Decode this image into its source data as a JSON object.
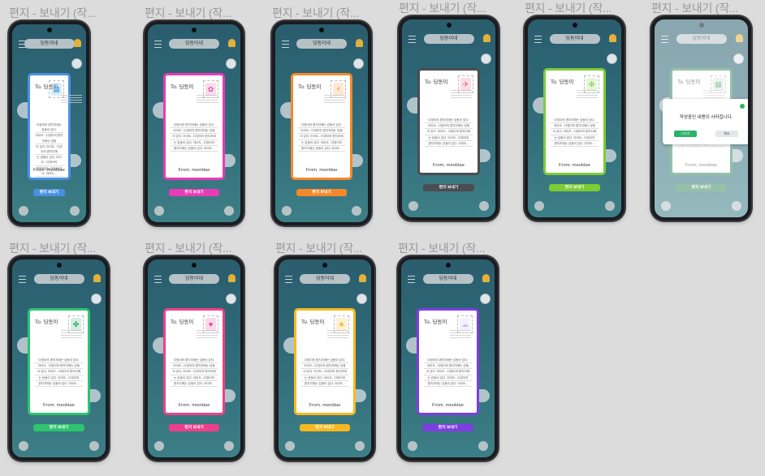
{
  "frames": [
    {
      "title": "편지 - 보내기 (작...",
      "accent": "#4a90e2",
      "stamp_icon": "postage-icon",
      "stamp_glyph": "▦",
      "stamp_color": "#4fa3e0"
    },
    {
      "title": "편지 - 보내기 (작...",
      "accent": "#e93bb5",
      "stamp_icon": "tulip-icon",
      "stamp_glyph": "✿",
      "stamp_color": "#e255a7"
    },
    {
      "title": "편지 - 보내기 (작...",
      "accent": "#f6882a",
      "stamp_icon": "bolt-icon",
      "stamp_glyph": "⚡",
      "stamp_color": "#f28a2b"
    },
    {
      "title": "편지 - 보내기 (작...",
      "accent": "#4a4d52",
      "stamp_icon": "rocket-icon",
      "stamp_glyph": "✈",
      "stamp_color": "#ea5c7a"
    },
    {
      "title": "편지 - 보내기 (작...",
      "accent": "#7ccc36",
      "stamp_icon": "clover-icon",
      "stamp_glyph": "✤",
      "stamp_color": "#8ccf56"
    },
    {
      "title": "편지 - 보내기 (작...",
      "accent": "#3f8f61",
      "stamp_icon": "postage-icon",
      "stamp_glyph": "▦",
      "stamp_color": "#55a06b"
    },
    {
      "title": "편지 - 보내기 (작...",
      "accent": "#2ec46e",
      "stamp_icon": "clover-icon",
      "stamp_glyph": "✤",
      "stamp_color": "#2ea868"
    },
    {
      "title": "편지 - 보내기 (작...",
      "accent": "#ef3f8a",
      "stamp_icon": "heart-icon",
      "stamp_glyph": "♥",
      "stamp_color": "#ef3f8a"
    },
    {
      "title": "편지 - 보내기 (작...",
      "accent": "#f7b91f",
      "stamp_icon": "star-icon",
      "stamp_glyph": "★",
      "stamp_color": "#f2b526"
    },
    {
      "title": "편지 - 보내기 (작...",
      "accent": "#7e3ee0",
      "stamp_icon": "cloud-icon",
      "stamp_glyph": "☁",
      "stamp_color": "#c7c0ef"
    }
  ],
  "header": {
    "title": "딩동이네"
  },
  "card": {
    "to": "To. 딩동이",
    "body": [
      "다영이의 편지지에는 감동이 있다.",
      "아이도...다영이의 편지지에는 감동",
      "이 있다. 아이도...다영이의 편지지에",
      "는 감동이 있다. 아이도...다영이의",
      "편지지에는 감동이 있다. 아이도..."
    ],
    "from": "From. meoldae"
  },
  "send_label": "편지 보내기",
  "dialog": {
    "message": "작성중인 내용이 사라집니다.",
    "confirm": "나가기",
    "cancel": "취소"
  }
}
